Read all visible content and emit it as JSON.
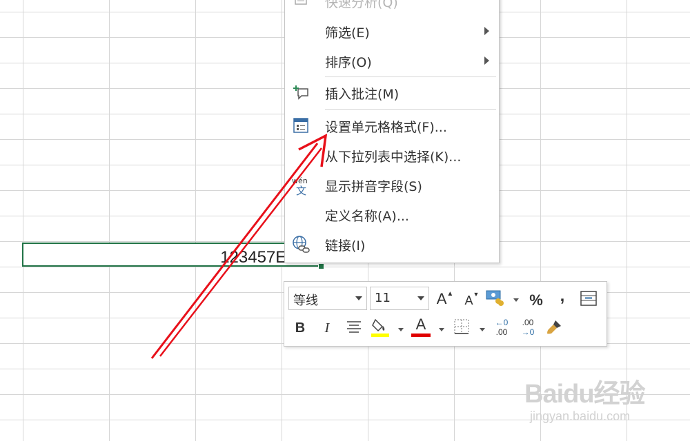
{
  "cell": {
    "value": "123457E+17"
  },
  "context_menu": {
    "items": [
      {
        "label": "快速分析(Q)",
        "icon": "quick-analysis-icon",
        "disabled": true
      },
      {
        "label": "筛选(E)",
        "icon": "",
        "submenu": true
      },
      {
        "label": "排序(O)",
        "icon": "",
        "submenu": true
      },
      {
        "label": "插入批注(M)",
        "icon": "insert-comment-icon"
      },
      {
        "label": "设置单元格格式(F)...",
        "icon": "format-cells-icon"
      },
      {
        "label": "从下拉列表中选择(K)...",
        "icon": ""
      },
      {
        "label": "显示拼音字段(S)",
        "icon": "phonetic-icon",
        "icon_text_top": "wén",
        "icon_text_bottom": "文"
      },
      {
        "label": "定义名称(A)...",
        "icon": ""
      },
      {
        "label": "链接(I)",
        "icon": "hyperlink-icon"
      }
    ]
  },
  "mini_toolbar": {
    "font_name": "等线",
    "font_size": "11",
    "increase_font_label": "A",
    "decrease_font_label": "A",
    "percent_label": "%",
    "comma_label": ",",
    "bold_label": "B",
    "italic_label": "I",
    "font_color_label": "A",
    "fill_color": "#ffff00",
    "font_color": "#e00000",
    "increase_decimal_label": ".00",
    "decrease_decimal_label": ".00"
  },
  "watermark": {
    "logo": "Baidu经验",
    "url": "jingyan.baidu.com"
  },
  "colors": {
    "selection_border": "#217346",
    "arrow": "#e8101a"
  }
}
